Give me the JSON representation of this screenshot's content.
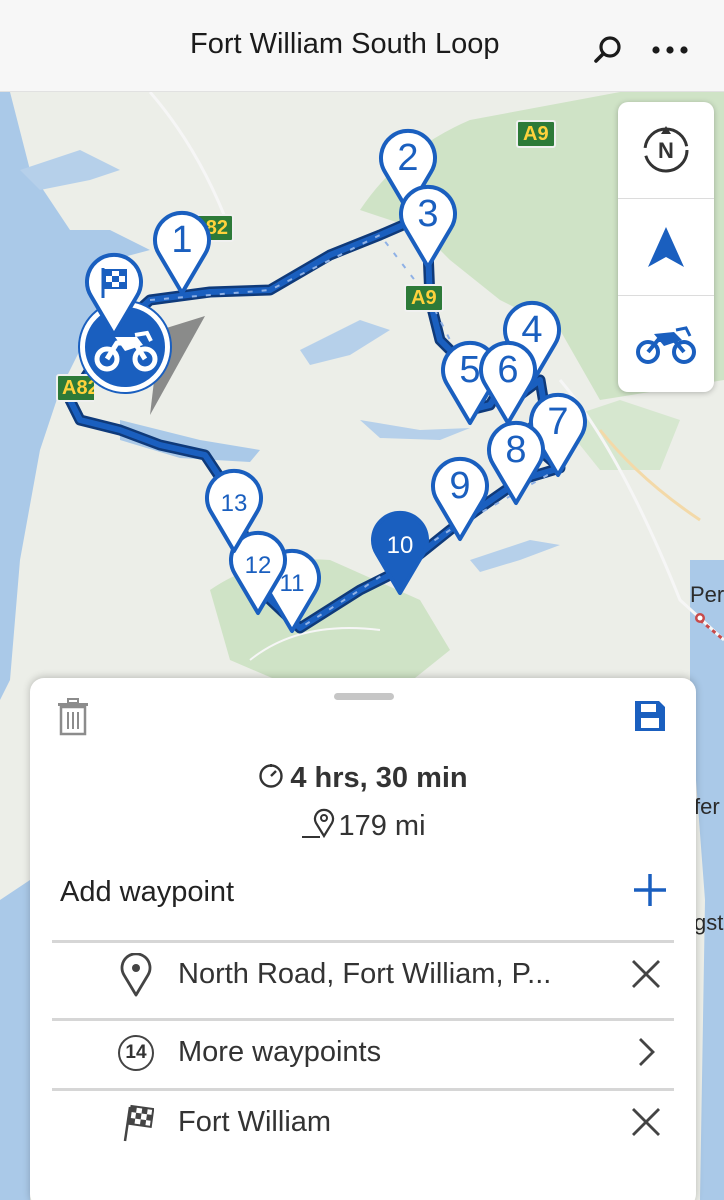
{
  "header": {
    "title": "Fort William South Loop"
  },
  "map": {
    "road_labels": [
      "A9",
      "A9",
      "A82",
      "A82"
    ],
    "town_label": "Per",
    "side_fragments": [
      "fer",
      "gst"
    ],
    "waypoint_pins": [
      "1",
      "2",
      "3",
      "4",
      "5",
      "6",
      "7",
      "8",
      "9",
      "10",
      "11",
      "12",
      "13"
    ],
    "colors": {
      "route": "#1a5fbf",
      "route_casing": "#0f3a7a",
      "pin_fill": "#ffffff",
      "water": "#aac9e8",
      "land": "#eceee8",
      "forest": "#cfe3c6"
    }
  },
  "controls": {
    "compass_icon": "compass-north-icon",
    "navigate_icon": "navigation-arrow-icon",
    "vehicle_icon": "motorbike-icon"
  },
  "route_sheet": {
    "duration": "4 hrs, 30 min",
    "distance": "179 mi",
    "add_waypoint_label": "Add waypoint",
    "waypoints": [
      {
        "icon": "location-pin-icon",
        "label": "North Road, Fort William, P...",
        "action": "close-icon"
      },
      {
        "icon": "count-badge-icon",
        "badge": "14",
        "label": "More waypoints",
        "action": "chevron-right-icon"
      },
      {
        "icon": "checkered-flag-icon",
        "label": "Fort William",
        "action": "close-icon"
      }
    ]
  }
}
